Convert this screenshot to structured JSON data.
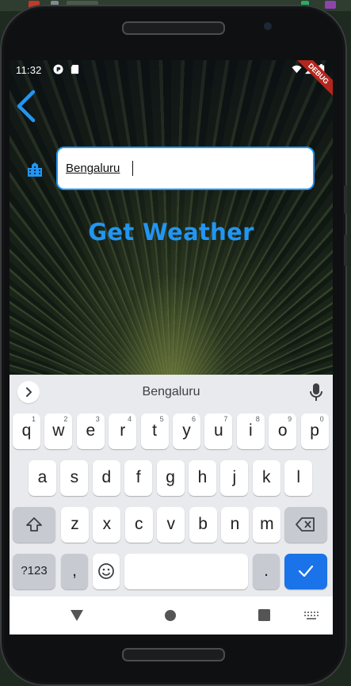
{
  "status_bar": {
    "time": "11:32",
    "debug_banner": "DEBUG"
  },
  "app": {
    "city_input_value": "Bengaluru",
    "get_weather_label": "Get Weather",
    "accent_color": "#2196f3"
  },
  "keyboard": {
    "suggestion": "Bengaluru",
    "row1": [
      {
        "label": "q",
        "hint": "1"
      },
      {
        "label": "w",
        "hint": "2"
      },
      {
        "label": "e",
        "hint": "3"
      },
      {
        "label": "r",
        "hint": "4"
      },
      {
        "label": "t",
        "hint": "5"
      },
      {
        "label": "y",
        "hint": "6"
      },
      {
        "label": "u",
        "hint": "7"
      },
      {
        "label": "i",
        "hint": "8"
      },
      {
        "label": "o",
        "hint": "9"
      },
      {
        "label": "p",
        "hint": "0"
      }
    ],
    "row2": [
      "a",
      "s",
      "d",
      "f",
      "g",
      "h",
      "j",
      "k",
      "l"
    ],
    "row3": [
      "z",
      "x",
      "c",
      "v",
      "b",
      "n",
      "m"
    ],
    "symbols_label": "?123",
    "comma_label": ",",
    "period_label": ".",
    "enter_color": "#1a73e8"
  },
  "icons": {
    "back": "chevron-left-icon",
    "city": "location-city-icon",
    "expand": "chevron-right-icon",
    "mic": "microphone-icon",
    "shift": "shift-icon",
    "backspace": "backspace-icon",
    "emoji": "emoji-icon",
    "enter": "checkmark-icon",
    "nav_back": "triangle-back-icon",
    "nav_home": "circle-home-icon",
    "nav_recents": "square-recents-icon",
    "nav_keyboard": "keyboard-switch-icon"
  }
}
